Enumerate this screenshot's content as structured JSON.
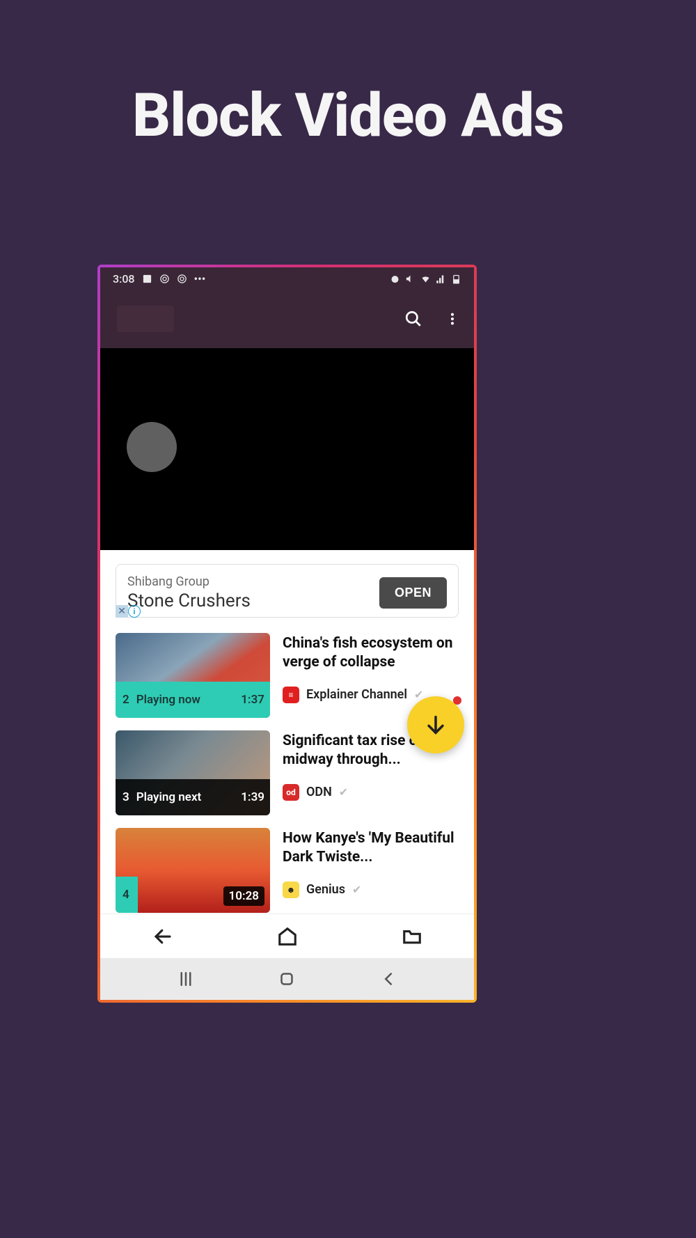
{
  "page": {
    "title": "Block Video Ads"
  },
  "status": {
    "time": "3:08",
    "dots": "•••"
  },
  "ad": {
    "sub": "Shibang Group",
    "main": "Stone Crushers",
    "button": "OPEN"
  },
  "videos": [
    {
      "index": "2",
      "status": "Playing now",
      "time": "1:37",
      "title": "China's fish ecosystem on verge of collapse",
      "channel": "Explainer Channel"
    },
    {
      "index": "3",
      "status": "Playing next",
      "time": "1:39",
      "title": "Significant tax rise come midway through...",
      "channel": "ODN"
    },
    {
      "index": "4",
      "status": "",
      "time": "10:28",
      "title": "How Kanye's 'My Beautiful Dark Twiste...",
      "channel": "Genius"
    }
  ]
}
